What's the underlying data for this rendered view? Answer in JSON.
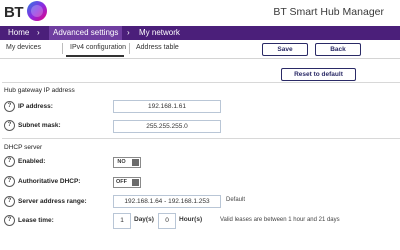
{
  "header": {
    "logo_text": "BT",
    "app_title": "BT Smart Hub Manager"
  },
  "breadcrumb": {
    "items": [
      "Home",
      "Advanced settings",
      "My network"
    ]
  },
  "tabs": [
    {
      "label": "My devices"
    },
    {
      "label": "IPv4 configuration"
    },
    {
      "label": "Address table"
    }
  ],
  "toolbar": {
    "save_label": "Save",
    "back_label": "Back",
    "reset_label": "Reset to default"
  },
  "gateway": {
    "heading": "Hub gateway IP address",
    "ip_label": "IP address:",
    "ip_value": "192.168.1.61",
    "subnet_label": "Subnet mask:",
    "subnet_value": "255.255.255.0"
  },
  "dhcp": {
    "heading": "DHCP server",
    "enabled_label": "Enabled:",
    "enabled_value": "NO",
    "auth_label": "Authoritative DHCP:",
    "auth_value": "OFF",
    "range_label": "Server address range:",
    "range_value": "192.168.1.64 - 192.168.1.253",
    "range_note": "Default",
    "lease_label": "Lease time:",
    "lease_days": "1",
    "days_unit": "Day(s)",
    "lease_hours": "0",
    "hours_unit": "Hour(s)",
    "lease_note": "Valid leases are between 1 hour and 21 days"
  },
  "icons": {
    "help": "?"
  }
}
